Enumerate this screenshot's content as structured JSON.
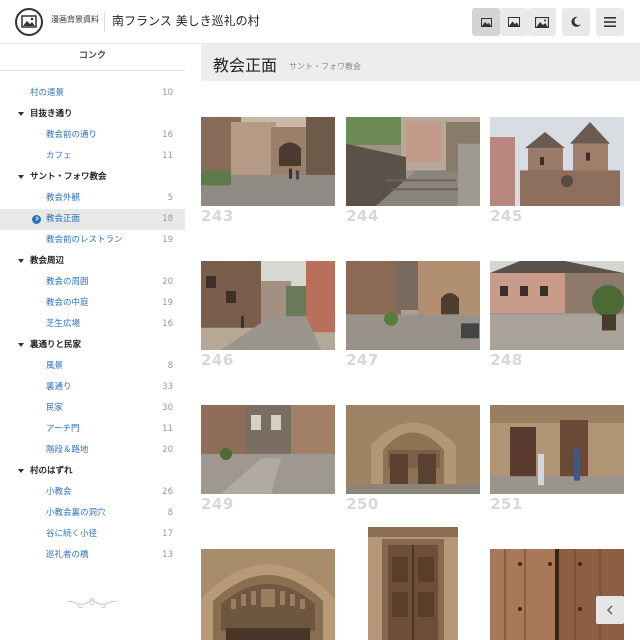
{
  "header": {
    "brand": "漫画背景資料",
    "site_title": "南フランス 美しき巡礼の村",
    "icons": [
      "image-small-icon",
      "image-medium-icon",
      "image-large-icon",
      "moon-icon",
      "menu-icon"
    ]
  },
  "sidebar": {
    "heading": "コンク",
    "items": [
      {
        "label": "村の遠景",
        "count": "10",
        "type": "link",
        "indent": 0
      },
      {
        "label": "目抜き通り",
        "count": "",
        "type": "group"
      },
      {
        "label": "教会前の通り",
        "count": "16",
        "type": "link",
        "indent": 1
      },
      {
        "label": "カフェ",
        "count": "11",
        "type": "link",
        "indent": 1
      },
      {
        "label": "サント・フォワ教会",
        "count": "",
        "type": "group"
      },
      {
        "label": "教会外観",
        "count": "5",
        "type": "link",
        "indent": 1
      },
      {
        "label": "教会正面",
        "count": "18",
        "type": "link",
        "indent": 1,
        "selected": true
      },
      {
        "label": "教会前のレストラン",
        "count": "19",
        "type": "link",
        "indent": 1
      },
      {
        "label": "教会周辺",
        "count": "",
        "type": "group"
      },
      {
        "label": "教会の周囲",
        "count": "20",
        "type": "link",
        "indent": 1
      },
      {
        "label": "教会の中庭",
        "count": "19",
        "type": "link",
        "indent": 1
      },
      {
        "label": "芝生広場",
        "count": "16",
        "type": "link",
        "indent": 1
      },
      {
        "label": "裏通りと民家",
        "count": "",
        "type": "group"
      },
      {
        "label": "風景",
        "count": "8",
        "type": "link",
        "indent": 1
      },
      {
        "label": "裏通り",
        "count": "33",
        "type": "link",
        "indent": 1
      },
      {
        "label": "民家",
        "count": "30",
        "type": "link",
        "indent": 1
      },
      {
        "label": "アーチ門",
        "count": "11",
        "type": "link",
        "indent": 1
      },
      {
        "label": "階段＆路地",
        "count": "20",
        "type": "link",
        "indent": 1
      },
      {
        "label": "村のはずれ",
        "count": "",
        "type": "group"
      },
      {
        "label": "小教会",
        "count": "26",
        "type": "link",
        "indent": 1
      },
      {
        "label": "小教会裏の洞穴",
        "count": "8",
        "type": "link",
        "indent": 1
      },
      {
        "label": "谷に続く小径",
        "count": "17",
        "type": "link",
        "indent": 1
      },
      {
        "label": "巡礼者の橋",
        "count": "13",
        "type": "link",
        "indent": 1
      }
    ]
  },
  "main": {
    "title": "教会正面",
    "subtitle": "サント・フォワ教会",
    "photos": [
      {
        "number": "243",
        "scene": "street"
      },
      {
        "number": "244",
        "scene": "stairs"
      },
      {
        "number": "245",
        "scene": "towers"
      },
      {
        "number": "246",
        "scene": "lane"
      },
      {
        "number": "247",
        "scene": "square"
      },
      {
        "number": "248",
        "scene": "houses"
      },
      {
        "number": "249",
        "scene": "plaza"
      },
      {
        "number": "250",
        "scene": "portal"
      },
      {
        "number": "251",
        "scene": "doors"
      },
      {
        "number": "",
        "scene": "tympanum"
      },
      {
        "number": "",
        "scene": "tall-door"
      },
      {
        "number": "",
        "scene": "wood-door"
      }
    ]
  },
  "colors": {
    "link": "#2d72c4",
    "selected_bg": "#e8e8e8",
    "number": "#d8d8d8"
  }
}
